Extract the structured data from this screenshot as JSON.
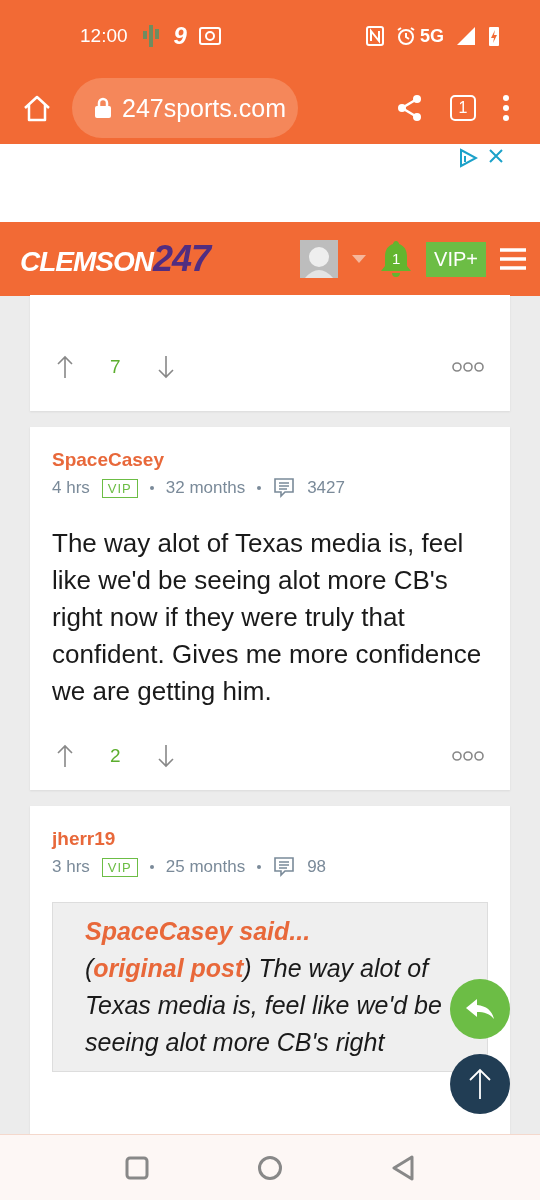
{
  "status_bar": {
    "time": "12:00",
    "app_badge": "9",
    "network": "5G"
  },
  "browser": {
    "url": "247sports.com",
    "tab_count": "1"
  },
  "site_header": {
    "logo_main": "CLEMSON",
    "logo_number": "247",
    "notification_count": "1",
    "vip_button": "VIP+"
  },
  "posts": [
    {
      "kind": "partial",
      "votes": "7"
    },
    {
      "kind": "full",
      "author": "SpaceCasey",
      "time": "4 hrs",
      "badge": "VIP",
      "tenure": "32 months",
      "post_count": "3427",
      "body": "The way alot of Texas media is, feel like we'd be seeing alot more CB's right now if they were truly that confident. Gives me more confidence we are getting him.",
      "votes": "2"
    },
    {
      "kind": "quote",
      "author": "jherr19",
      "time": "3 hrs",
      "badge": "VIP",
      "tenure": "25 months",
      "post_count": "98",
      "quote": {
        "author_link": "SpaceCasey said...",
        "source_open": "(",
        "source_link": "original post",
        "source_close": ")",
        "text": "The way alot of Texas media is, feel like we'd be seeing alot more CB's right"
      }
    }
  ]
}
